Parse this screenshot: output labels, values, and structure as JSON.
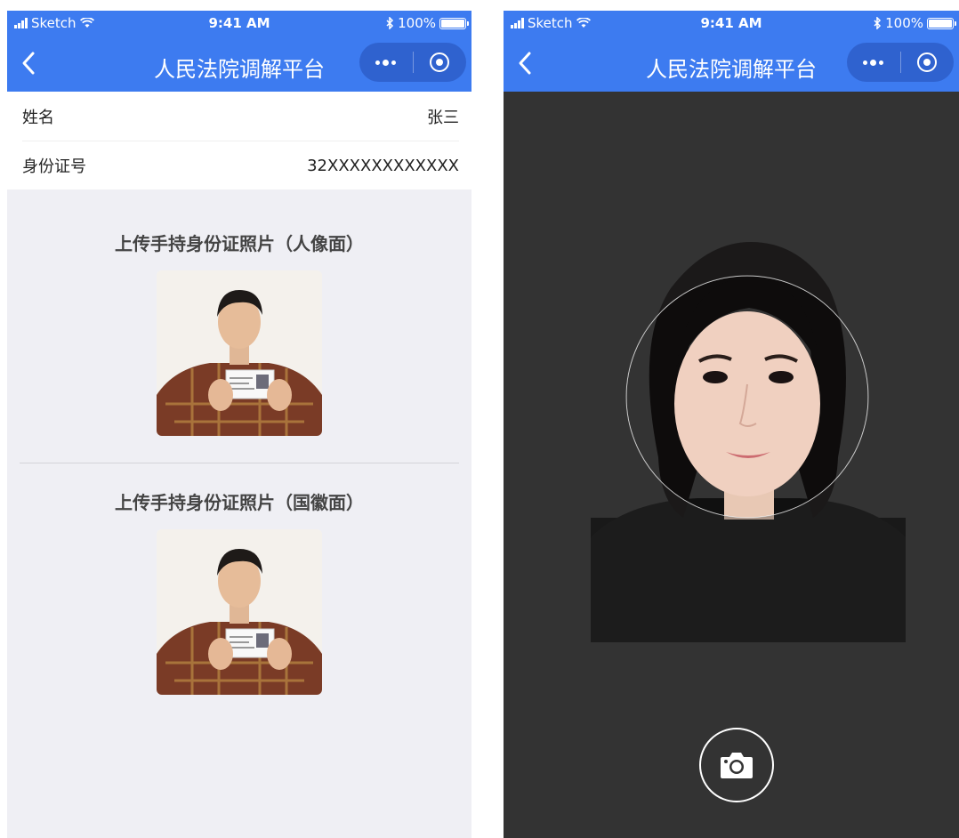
{
  "status": {
    "carrier": "Sketch",
    "time": "9:41 AM",
    "battery": "100%"
  },
  "nav": {
    "title": "人民法院调解平台"
  },
  "form": {
    "name_label": "姓名",
    "name_value": "张三",
    "id_label": "身份证号",
    "id_value": "32XXXXXXXXXXXX"
  },
  "uploads": {
    "front_title": "上传手持身份证照片（人像面）",
    "back_title": "上传手持身份证照片（国徽面）"
  },
  "icons": {
    "back": "chevron-left-icon",
    "more": "more-dots-icon",
    "home": "target-circle-icon",
    "camera": "camera-icon"
  },
  "colors": {
    "navbar": "#3d7bf0",
    "background": "#efeff4",
    "camera_bg": "#333333"
  }
}
